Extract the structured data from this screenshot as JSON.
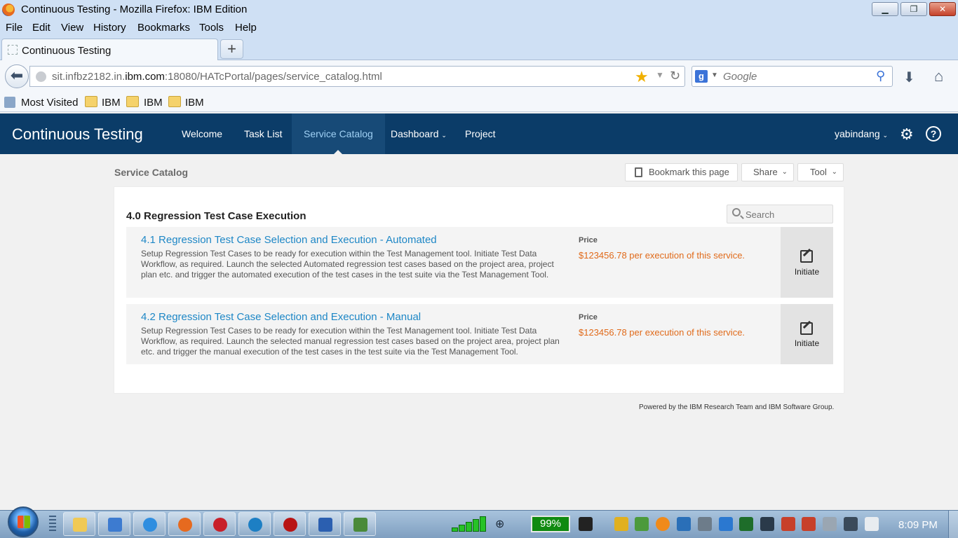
{
  "browser": {
    "window_title": "Continuous Testing - Mozilla Firefox: IBM Edition",
    "menu": [
      "File",
      "Edit",
      "View",
      "History",
      "Bookmarks",
      "Tools",
      "Help"
    ],
    "tab_title": "Continuous Testing",
    "url_prefix": "sit.infbz2182.in.",
    "url_domain": "ibm.com",
    "url_suffix": ":18080/HATcPortal/pages/service_catalog.html",
    "search_placeholder": "Google",
    "bookmarks": [
      "Most Visited",
      "IBM",
      "IBM",
      "IBM"
    ]
  },
  "app": {
    "brand": "Continuous Testing",
    "nav": [
      "Welcome",
      "Task List",
      "Service Catalog",
      "Dashboard",
      "Project"
    ],
    "active_nav": "Service Catalog",
    "user": "yabindang"
  },
  "page": {
    "breadcrumb": "Service Catalog",
    "toolbar": {
      "bookmark": "Bookmark this page",
      "share": "Share",
      "tool": "Tool"
    },
    "section_title": "4.0 Regression Test Case Execution",
    "search_placeholder": "Search",
    "services": [
      {
        "title": "4.1 Regression Test Case Selection and Execution - Automated",
        "description": "Setup Regression Test Cases to be ready for execution within the Test Management tool. Initiate Test Data Workflow, as required. Launch the selected Automated regression test cases based on the project area, project plan etc. and trigger the automated execution of the test cases in the test suite via the Test Management Tool.",
        "price_label": "Price",
        "price": "$123456.78 per execution of this service.",
        "action": "Initiate"
      },
      {
        "title": "4.2 Regression Test Case Selection and Execution - Manual",
        "description": "Setup Regression Test Cases to be ready for execution within the Test Management tool. Initiate Test Data Workflow, as required. Launch the selected manual regression test cases based on the project area, project plan etc. and trigger the manual execution of the test cases in the test suite via the Test Management Tool.",
        "price_label": "Price",
        "price": "$123456.78 per execution of this service.",
        "action": "Initiate"
      }
    ],
    "footer": "Powered by the IBM Research Team and IBM Software Group."
  },
  "taskbar": {
    "battery": "99%",
    "clock": "8:09 PM"
  },
  "colors": {
    "app_header": "#0b3c68",
    "link": "#1e87c6",
    "price": "#e06a1a"
  }
}
